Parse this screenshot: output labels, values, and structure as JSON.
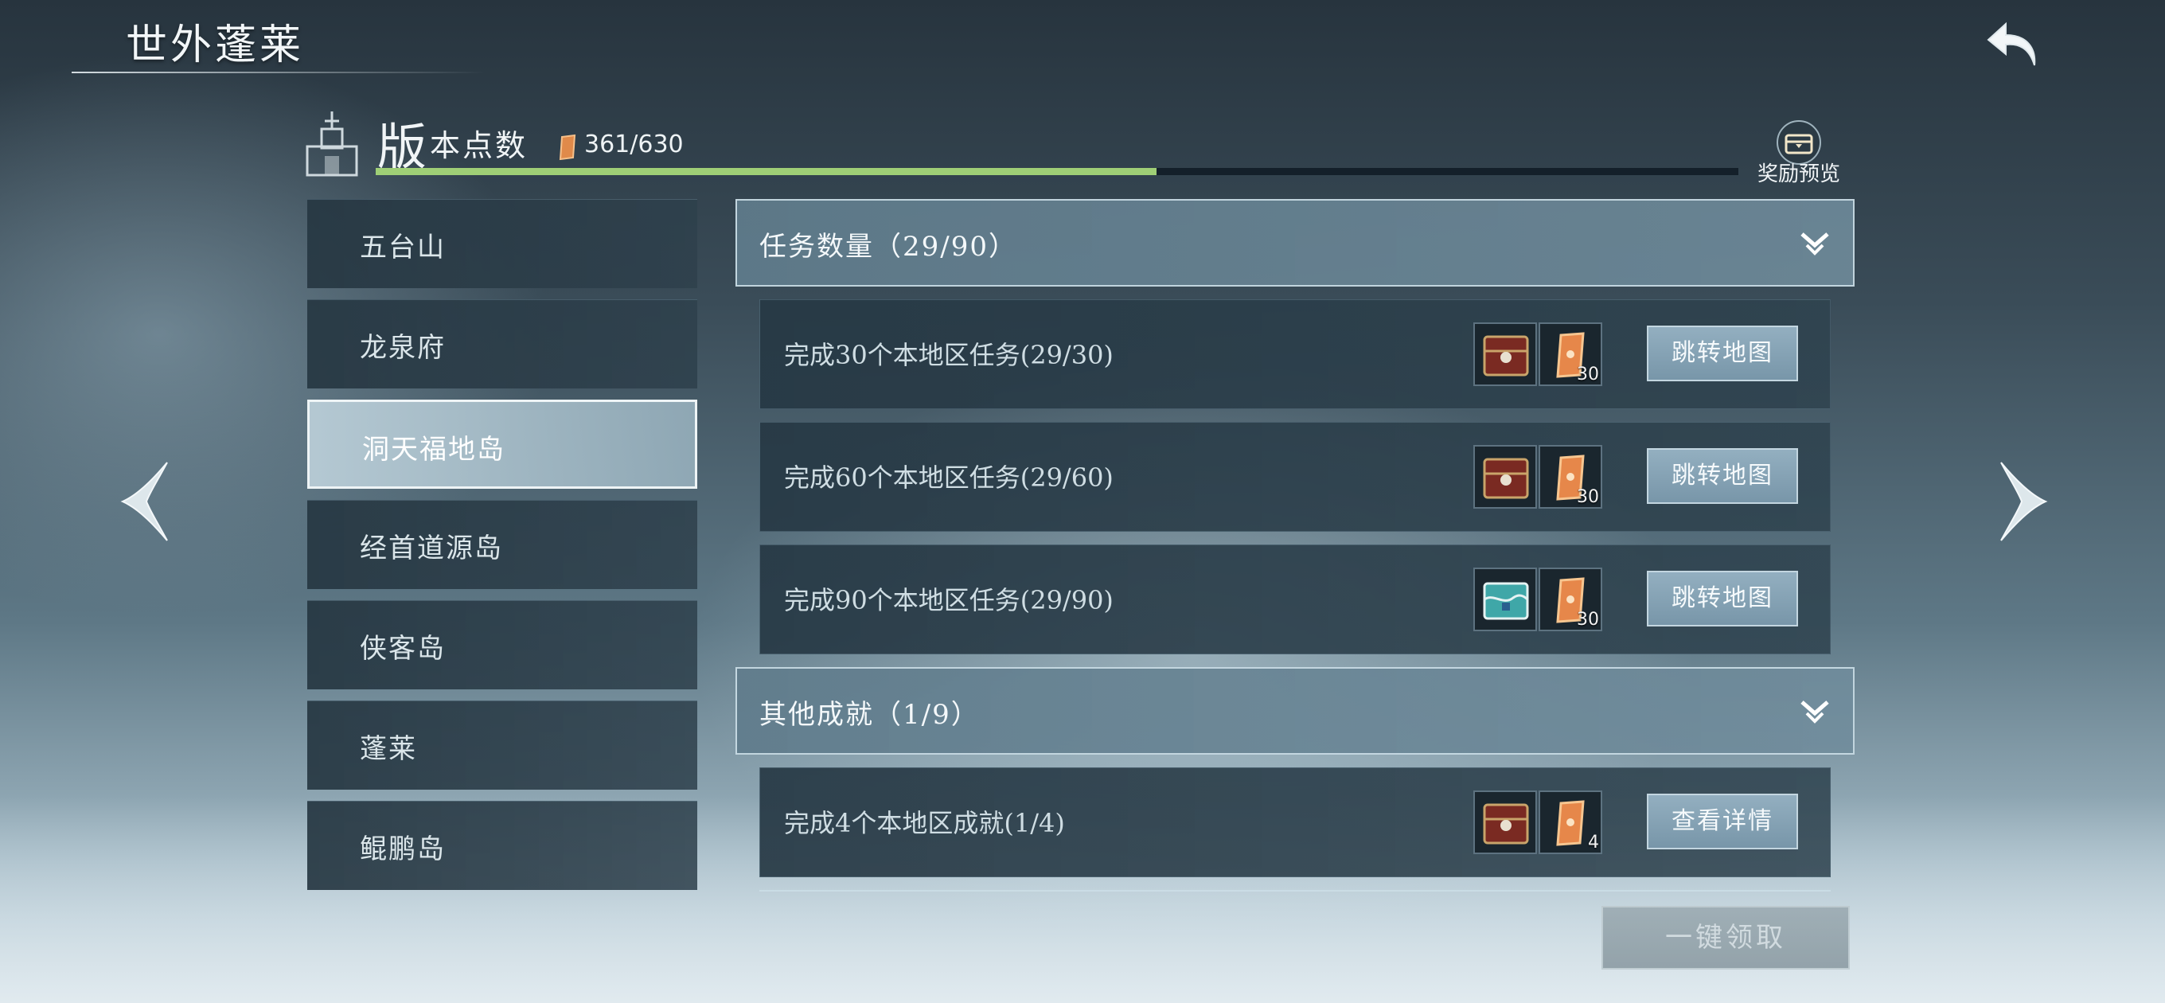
{
  "header": {
    "title": "世外蓬莱",
    "back_icon": "return-arrow-icon"
  },
  "version_points": {
    "title_big": "版",
    "title_small": "本点数",
    "count": "361/630",
    "progress": 0.573,
    "progress_color": "#9fcf76",
    "reward_preview_label": "奖励预览"
  },
  "sidebar": {
    "items": [
      {
        "label": "五台山"
      },
      {
        "label": "龙泉府"
      },
      {
        "label": "洞天福地岛"
      },
      {
        "label": "经首道源岛"
      },
      {
        "label": "侠客岛"
      },
      {
        "label": "蓬莱"
      },
      {
        "label": "鲲鹏岛"
      }
    ],
    "active_index": 2
  },
  "sections": [
    {
      "label": "任务数量（29/90）",
      "tasks": [
        {
          "text": "完成30个本地区任务(29/30)",
          "reward1": "red-chest-icon",
          "reward2_qty": "30",
          "button": "跳转地图"
        },
        {
          "text": "完成60个本地区任务(29/60)",
          "reward1": "red-chest-icon",
          "reward2_qty": "30",
          "button": "跳转地图"
        },
        {
          "text": "完成90个本地区任务(29/90)",
          "reward1": "teal-chest-icon",
          "reward2_qty": "30",
          "button": "跳转地图"
        }
      ]
    },
    {
      "label": "其他成就（1/9）",
      "tasks": [
        {
          "text": "完成4个本地区成就(1/4)",
          "reward1": "red-chest-icon",
          "reward2_qty": "4",
          "button": "查看详情"
        }
      ]
    }
  ],
  "claim_all_label": "一键领取"
}
